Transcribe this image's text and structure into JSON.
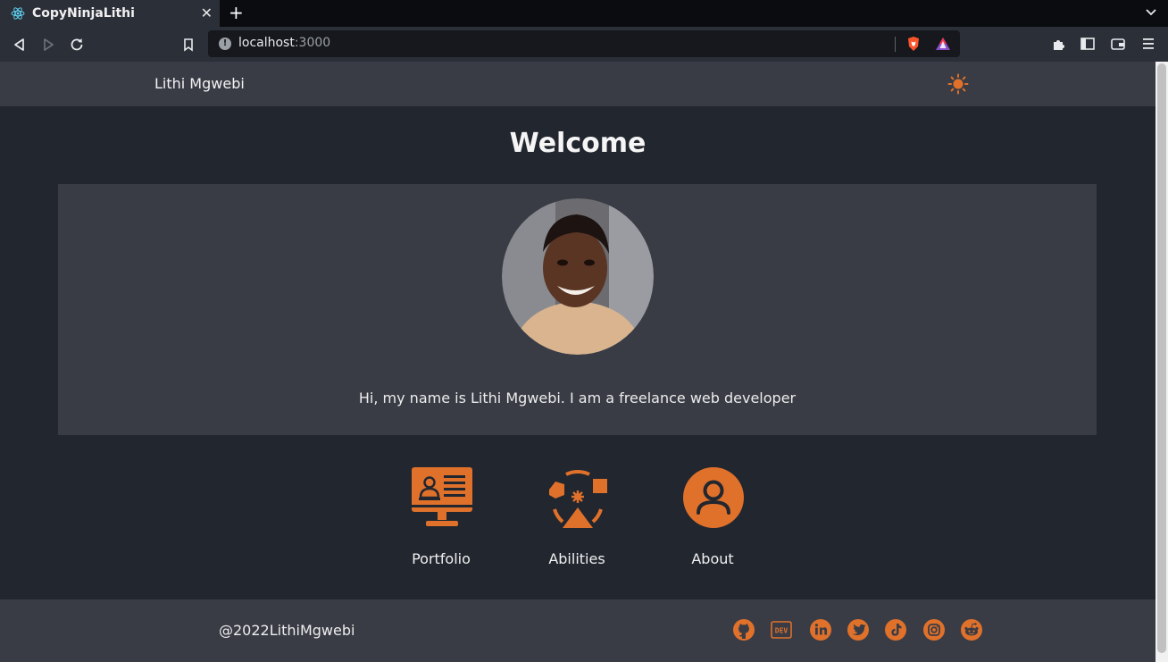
{
  "browser": {
    "tab_title": "CopyNinjaLithi",
    "url_host": "localhost",
    "url_port": ":3000"
  },
  "header": {
    "brand": "Lithi Mgwebi",
    "theme_icon": "sun-icon"
  },
  "main": {
    "heading": "Welcome",
    "intro": "Hi, my name is Lithi Mgwebi. I am a freelance web developer",
    "cards": [
      {
        "label": "Portfolio",
        "icon": "monitor-profile-icon"
      },
      {
        "label": "Abilities",
        "icon": "shapes-gear-icon"
      },
      {
        "label": "About",
        "icon": "user-circle-icon"
      }
    ]
  },
  "footer": {
    "copyright": "@2022LithiMgwebi",
    "social": [
      "github-icon",
      "dev-icon",
      "linkedin-icon",
      "twitter-icon",
      "tiktok-icon",
      "instagram-icon",
      "reddit-icon"
    ]
  },
  "colors": {
    "accent": "#e0712b",
    "page_bg": "#22262f",
    "panel_bg": "#393c45"
  }
}
